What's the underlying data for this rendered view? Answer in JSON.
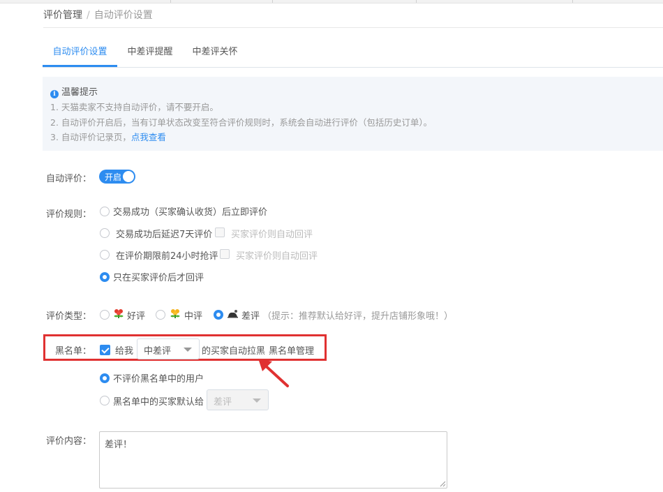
{
  "breadcrumb": {
    "root": "评价管理",
    "separator": "/",
    "current": "自动评价设置"
  },
  "tabs": [
    {
      "label": "自动评价设置",
      "active": true
    },
    {
      "label": "中差评提醒",
      "active": false
    },
    {
      "label": "中差评关怀",
      "active": false
    }
  ],
  "tip": {
    "title": "温馨提示",
    "line1": "1. 天猫卖家不支持自动评价，请不要开启。",
    "line2": "2. 自动评价开启后，当有订单状态改变至符合评价规则时，系统会自动进行评价（包括历史订单）。",
    "line3_prefix": "3. 自动评价记录页，",
    "line3_link": "点我查看"
  },
  "auto_eval": {
    "label": "自动评价：",
    "switch_text": "开启",
    "on": true
  },
  "rules": {
    "label": "评价规则：",
    "options": [
      {
        "text": "交易成功（买家确认收货）后立即评价",
        "checked": false
      },
      {
        "text": "交易成功后延迟7天评价",
        "checked": false,
        "extra": "买家评价则自动回评"
      },
      {
        "text": "在评价期限前24小时抢评",
        "checked": false,
        "extra": "买家评价则自动回评"
      },
      {
        "text": "只在买家评价后才回评",
        "checked": true
      }
    ]
  },
  "eval_type": {
    "label": "评价类型：",
    "options": [
      {
        "text": "好评",
        "icon": "good-rating-icon",
        "checked": false
      },
      {
        "text": "中评",
        "icon": "neutral-rating-icon",
        "checked": false
      },
      {
        "text": "差评",
        "icon": "bad-rating-icon",
        "checked": true
      }
    ],
    "hint": "（提示：推荐默认给好评，提升店铺形象哦！）"
  },
  "blacklist": {
    "label": "黑名单：",
    "checked": true,
    "give_me": "给我",
    "select_value": "中差评",
    "suffix": "的买家自动拉黑",
    "manage_link": "黑名单管理",
    "option1": "不评价黑名单中的用户",
    "option2": "黑名单中的买家默认给",
    "option2_select": "差评"
  },
  "content": {
    "label": "评价内容：",
    "value": "差评！"
  },
  "colors": {
    "accent": "#2d8cf0",
    "highlight": "#e03131",
    "tip_bg": "#f3f6fa"
  }
}
